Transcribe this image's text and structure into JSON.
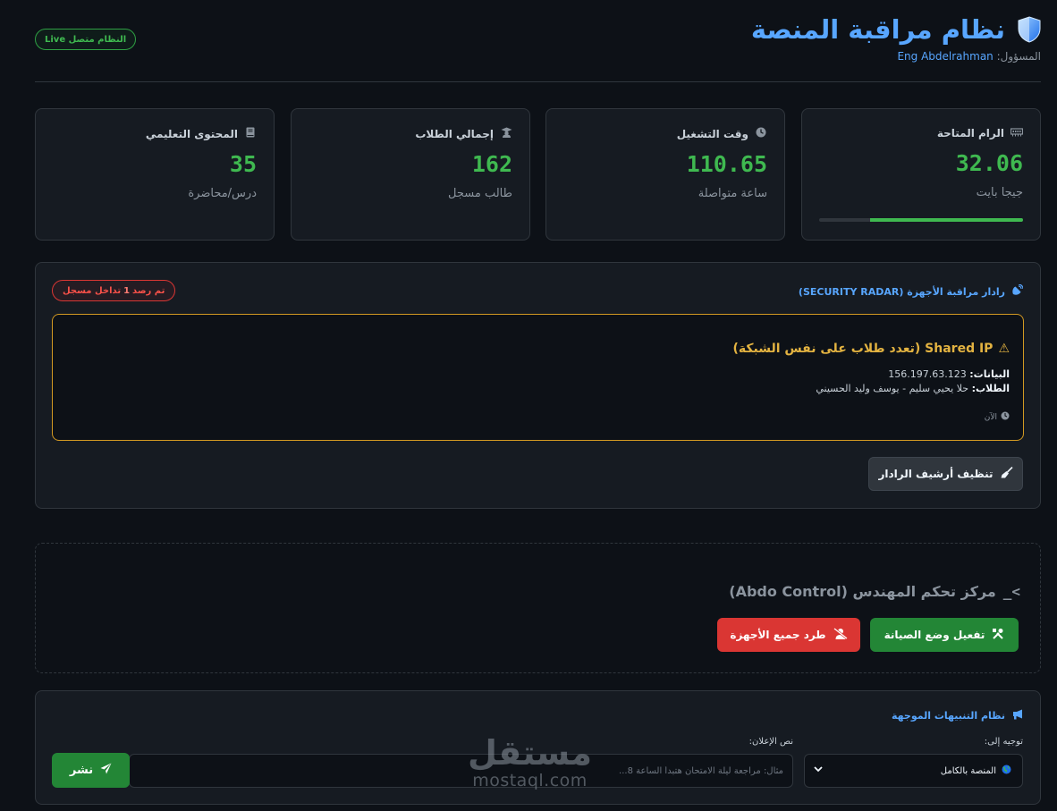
{
  "header": {
    "title": "نظام مراقبة المنصة",
    "admin_label": "المسؤول:",
    "admin_name": "Eng Abdelrahman",
    "live_badge": "النظام متصل Live"
  },
  "stats": [
    {
      "label": "الرام المتاحة",
      "icon": "ram-icon",
      "value": "32.06",
      "unit": "جيجا بايت",
      "progress": 0.75
    },
    {
      "label": "وقت التشغيل",
      "icon": "clock-icon",
      "value": "110.65",
      "unit": "ساعة متواصلة"
    },
    {
      "label": "إجمالي الطلاب",
      "icon": "graduate-icon",
      "value": "162",
      "unit": "طالب مسجل"
    },
    {
      "label": "المحتوى التعليمي",
      "icon": "book-icon",
      "value": "35",
      "unit": "درس/محاضرة"
    }
  ],
  "radar": {
    "title": "رادار مراقبة الأجهزة (SECURITY RADAR)",
    "badge_prefix": "تم رصد",
    "badge_count": "1",
    "badge_suffix": "تداخل مسجل",
    "alert": {
      "title": "Shared IP (تعدد طلاب على نفس الشبكة)",
      "data_label": "البيانات:",
      "data_value": "156.197.63.123",
      "students_label": "الطلاب:",
      "students_value": "حلا يحيي سليم - يوسف وليد الحسيني",
      "time": "الآن"
    },
    "clean_button": "تنظيف أرشيف الرادار"
  },
  "control": {
    "title": "مركز تحكم المهندس (Abdo Control)",
    "maintenance_button": "تفعيل وضع الصيانة",
    "kick_button": "طرد جميع الأجهزة"
  },
  "notify": {
    "title": "نظام التنبيهات الموجهة",
    "target_label": "توجيه إلى:",
    "target_value": "المنصة بالكامل",
    "message_label": "نص الإعلان:",
    "message_placeholder": "مثال: مراجعة ليلة الامتحان هتبدأ الساعة 8...",
    "publish_button": "نشر"
  },
  "watermark": {
    "arabic": "مستقل",
    "latin": "mostaql.com"
  },
  "colors": {
    "accent": "#58a6ff",
    "success": "#3fb950",
    "danger": "#da3633",
    "warning": "#e3b341",
    "background": "#0d1117",
    "panel": "#161b22"
  }
}
